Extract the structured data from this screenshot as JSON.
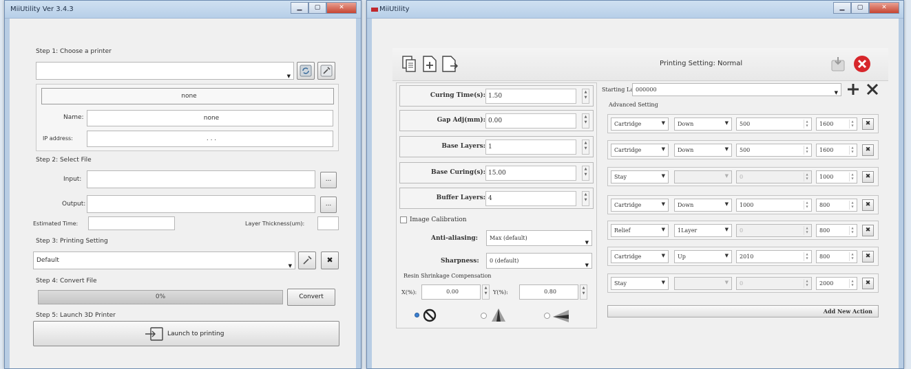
{
  "left_window": {
    "title": "MiiUtility Ver 3.4.3",
    "step1_label": "Step 1: Choose a printer",
    "printer_selected": "",
    "printer_header": "none",
    "name_label": "Name:",
    "name_value": "none",
    "ip_label": "IP address:",
    "ip_value": ". . .",
    "step2_label": "Step 2: Select File",
    "input_label": "Input:",
    "input_value": "",
    "output_label": "Output:",
    "output_value": "",
    "browse_label": "...",
    "estimated_time_label": "Estimated Time:",
    "estimated_time_value": "",
    "layer_thickness_label": "Layer Thickness(um):",
    "layer_thickness_value": "",
    "step3_label": "Step 3: Printing Setting",
    "printing_setting_value": "Default",
    "step4_label": "Step 4: Convert File",
    "progress_text": "0%",
    "progress_fraction": 0,
    "convert_label": "Convert",
    "step5_label": "Step 5: Launch 3D Printer",
    "launch_label": "Launch to printing"
  },
  "right_window": {
    "title": "MiiUtility",
    "printing_setting_title": "Printing Setting: Normal",
    "params": [
      {
        "label": "Curing Time(s):",
        "value": "1.50"
      },
      {
        "label": "Gap Adj(mm):",
        "value": "0.00"
      },
      {
        "label": "Base Layers:",
        "value": "1"
      },
      {
        "label": "Base Curing(s):",
        "value": "15.00"
      },
      {
        "label": "Buffer Layers:",
        "value": "4"
      }
    ],
    "image_calibration_label": "Image Calibration",
    "anti_aliasing_label": "Anti-aliasing:",
    "anti_aliasing_value": "Max (default)",
    "sharpness_label": "Sharpness:",
    "sharpness_value": "0 (default)",
    "shrinkage_label": "Resin Shrinkage Compensation",
    "x_label": "X(%):",
    "x_value": "0.00",
    "y_label": "Y(%):",
    "y_value": "0.80",
    "starting_layer_label": "Starting Layer:",
    "starting_layer_value": "000000",
    "advanced_setting_label": "Advanced Setting",
    "actions": [
      {
        "action": "Cartridge",
        "dir": "Down",
        "dist": "500",
        "speed": "1600",
        "dir_enabled": true
      },
      {
        "action": "Cartridge",
        "dir": "Down",
        "dist": "500",
        "speed": "1600",
        "dir_enabled": true
      },
      {
        "action": "Stay",
        "dir": "",
        "dist": "0",
        "speed": "1000",
        "dir_enabled": false
      },
      {
        "action": "Cartridge",
        "dir": "Down",
        "dist": "1000",
        "speed": "800",
        "dir_enabled": true
      },
      {
        "action": "Relief",
        "dir": "1Layer",
        "dist": "0",
        "speed": "800",
        "dir_enabled": true
      },
      {
        "action": "Cartridge",
        "dir": "Up",
        "dist": "2010",
        "speed": "800",
        "dir_enabled": true
      },
      {
        "action": "Stay",
        "dir": "",
        "dist": "0",
        "speed": "2000",
        "dir_enabled": false
      }
    ],
    "add_action_label": "Add New Action",
    "colors": {
      "close_red": "#d7262b",
      "frame_blue": "#b8cde4"
    }
  }
}
